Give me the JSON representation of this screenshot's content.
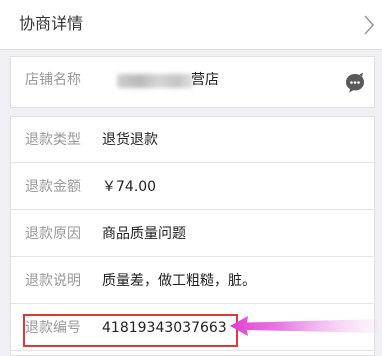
{
  "header": {
    "title": "协商详情"
  },
  "store": {
    "label": "店铺名称",
    "name_suffix": "营店"
  },
  "refund": {
    "rows": [
      {
        "label": "退款类型",
        "value": "退货退款"
      },
      {
        "label": "退款金额",
        "value": "￥74.00"
      },
      {
        "label": "退款原因",
        "value": "商品质量问题"
      },
      {
        "label": "退款说明",
        "value": "质量差，做工粗糙，脏。"
      },
      {
        "label": "退款编号",
        "value": "41819343037663"
      }
    ]
  },
  "colors": {
    "highlight": "#d93a3a",
    "arrow": "#e23ed2",
    "background": "#efeff4"
  },
  "icons": {
    "header": "chevron-right-icon",
    "store": "chat-bubble-icon"
  }
}
